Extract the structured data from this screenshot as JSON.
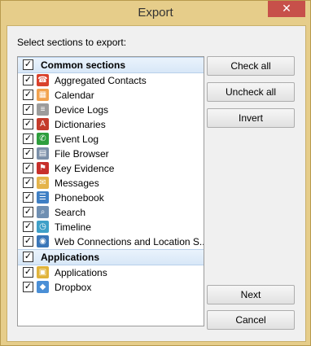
{
  "window": {
    "title": "Export",
    "close_glyph": "✕"
  },
  "instructions": "Select sections to export:",
  "groups": [
    {
      "label": "Common sections",
      "checked": true,
      "items": [
        {
          "label": "Aggregated Contacts",
          "icon": "contacts-icon",
          "color": "#d9412c"
        },
        {
          "label": "Calendar",
          "icon": "calendar-icon",
          "color": "#f2a24e"
        },
        {
          "label": "Device Logs",
          "icon": "device-log-icon",
          "color": "#9c9c9c"
        },
        {
          "label": "Dictionaries",
          "icon": "dictionary-icon",
          "color": "#c43b2b"
        },
        {
          "label": "Event Log",
          "icon": "phone-icon",
          "color": "#2e9e3d"
        },
        {
          "label": "File Browser",
          "icon": "file-browser-icon",
          "color": "#7b8fa8"
        },
        {
          "label": "Key Evidence",
          "icon": "key-evidence-icon",
          "color": "#c7302b"
        },
        {
          "label": "Messages",
          "icon": "messages-icon",
          "color": "#e4b34a"
        },
        {
          "label": "Phonebook",
          "icon": "phonebook-icon",
          "color": "#3f7fc4"
        },
        {
          "label": "Search",
          "icon": "search-icon",
          "color": "#6f8fb2"
        },
        {
          "label": "Timeline",
          "icon": "timeline-icon",
          "color": "#3fa0c8"
        },
        {
          "label": "Web Connections and Location S...",
          "icon": "web-connections-icon",
          "color": "#3a76b8"
        }
      ]
    },
    {
      "label": "Applications",
      "checked": true,
      "items": [
        {
          "label": "Applications",
          "icon": "applications-icon",
          "color": "#e0b33a"
        },
        {
          "label": "Dropbox",
          "icon": "dropbox-icon",
          "color": "#4a8fd6"
        }
      ]
    }
  ],
  "buttons": {
    "check_all": "Check all",
    "uncheck_all": "Uncheck all",
    "invert": "Invert",
    "next": "Next",
    "cancel": "Cancel"
  }
}
